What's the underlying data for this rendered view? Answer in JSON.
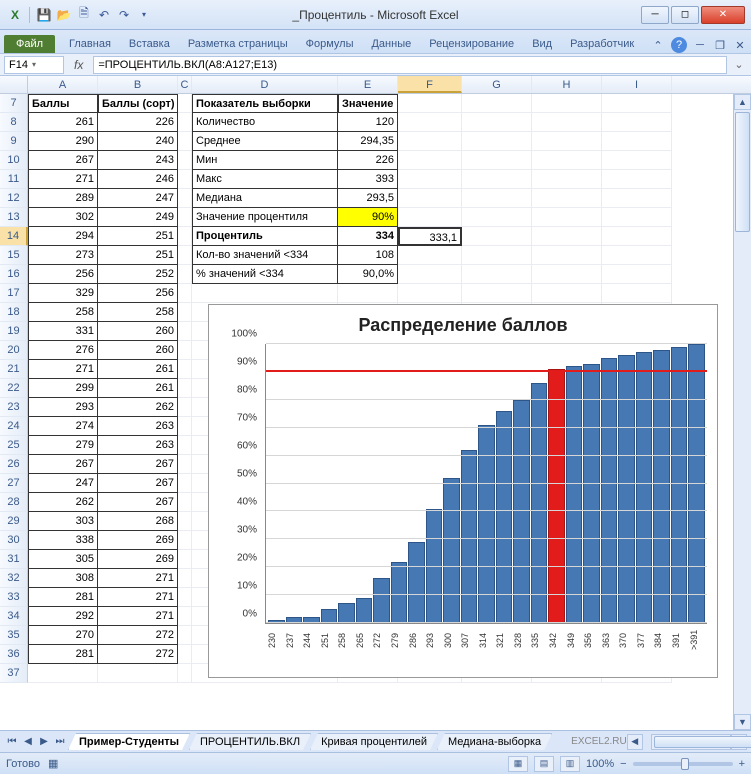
{
  "window": {
    "title": "_Процентиль - Microsoft Excel"
  },
  "qat": {
    "excel_icon": "X",
    "save": "💾",
    "undo": "↶",
    "redo": "↷"
  },
  "ribbon": {
    "file": "Файл",
    "tabs": [
      "Главная",
      "Вставка",
      "Разметка страницы",
      "Формулы",
      "Данные",
      "Рецензирование",
      "Вид",
      "Разработчик"
    ]
  },
  "name_box": "F14",
  "formula": "=ПРОЦЕНТИЛЬ.ВКЛ(A8:A127;E13)",
  "columns": [
    "A",
    "B",
    "C",
    "D",
    "E",
    "F",
    "G",
    "H",
    "I"
  ],
  "row_start": 7,
  "row_end": 37,
  "headers": {
    "A": "Баллы",
    "B": "Баллы (сорт)",
    "D": "Показатель выборки",
    "E": "Значение"
  },
  "dataAB": [
    [
      261,
      226
    ],
    [
      290,
      240
    ],
    [
      267,
      243
    ],
    [
      271,
      246
    ],
    [
      289,
      247
    ],
    [
      302,
      249
    ],
    [
      294,
      251
    ],
    [
      273,
      251
    ],
    [
      256,
      252
    ],
    [
      329,
      256
    ],
    [
      258,
      258
    ],
    [
      331,
      260
    ],
    [
      276,
      260
    ],
    [
      271,
      261
    ],
    [
      299,
      261
    ],
    [
      293,
      262
    ],
    [
      274,
      263
    ],
    [
      279,
      263
    ],
    [
      267,
      267
    ],
    [
      247,
      267
    ],
    [
      262,
      267
    ],
    [
      303,
      268
    ],
    [
      338,
      269
    ],
    [
      305,
      269
    ],
    [
      308,
      271
    ],
    [
      281,
      271
    ],
    [
      292,
      271
    ],
    [
      270,
      272
    ],
    [
      281,
      272
    ]
  ],
  "stats": [
    {
      "label": "Количество",
      "value": "120"
    },
    {
      "label": "Среднее",
      "value": "294,35"
    },
    {
      "label": "Мин",
      "value": "226"
    },
    {
      "label": "Макс",
      "value": "393"
    },
    {
      "label": "Медиана",
      "value": "293,5"
    },
    {
      "label": "Значение процентиля",
      "value": "90%",
      "yellow": true
    },
    {
      "label": "Процентиль",
      "value": "334",
      "bold": true,
      "f14": "333,1"
    },
    {
      "label": "Кол-во значений <334",
      "value": "108"
    },
    {
      "label": "% значений <334",
      "value": "90,0%"
    }
  ],
  "sheet_tabs": [
    "Пример-Студенты",
    "ПРОЦЕНТИЛЬ.ВКЛ",
    "Кривая процентилей",
    "Медиана-выборка"
  ],
  "watermark": "EXCEL2.RU",
  "status": {
    "ready": "Готово",
    "zoom": "100%"
  },
  "chart_data": {
    "type": "bar",
    "title": "Распределение баллов",
    "ylabel": "",
    "ylim": [
      0,
      100
    ],
    "yticks": [
      "0%",
      "10%",
      "20%",
      "30%",
      "40%",
      "50%",
      "60%",
      "70%",
      "80%",
      "90%",
      "100%"
    ],
    "reference_line": 90,
    "categories": [
      "230",
      "237",
      "244",
      "251",
      "258",
      "265",
      "272",
      "279",
      "286",
      "293",
      "300",
      "307",
      "314",
      "321",
      "328",
      "335",
      "342",
      "349",
      "356",
      "363",
      "370",
      "377",
      "384",
      "391",
      ">391"
    ],
    "values": [
      1,
      2,
      2,
      5,
      7,
      9,
      16,
      22,
      29,
      41,
      52,
      62,
      71,
      76,
      80,
      86,
      91,
      92,
      93,
      95,
      96,
      97,
      98,
      99,
      100
    ],
    "highlight_index": 16
  }
}
